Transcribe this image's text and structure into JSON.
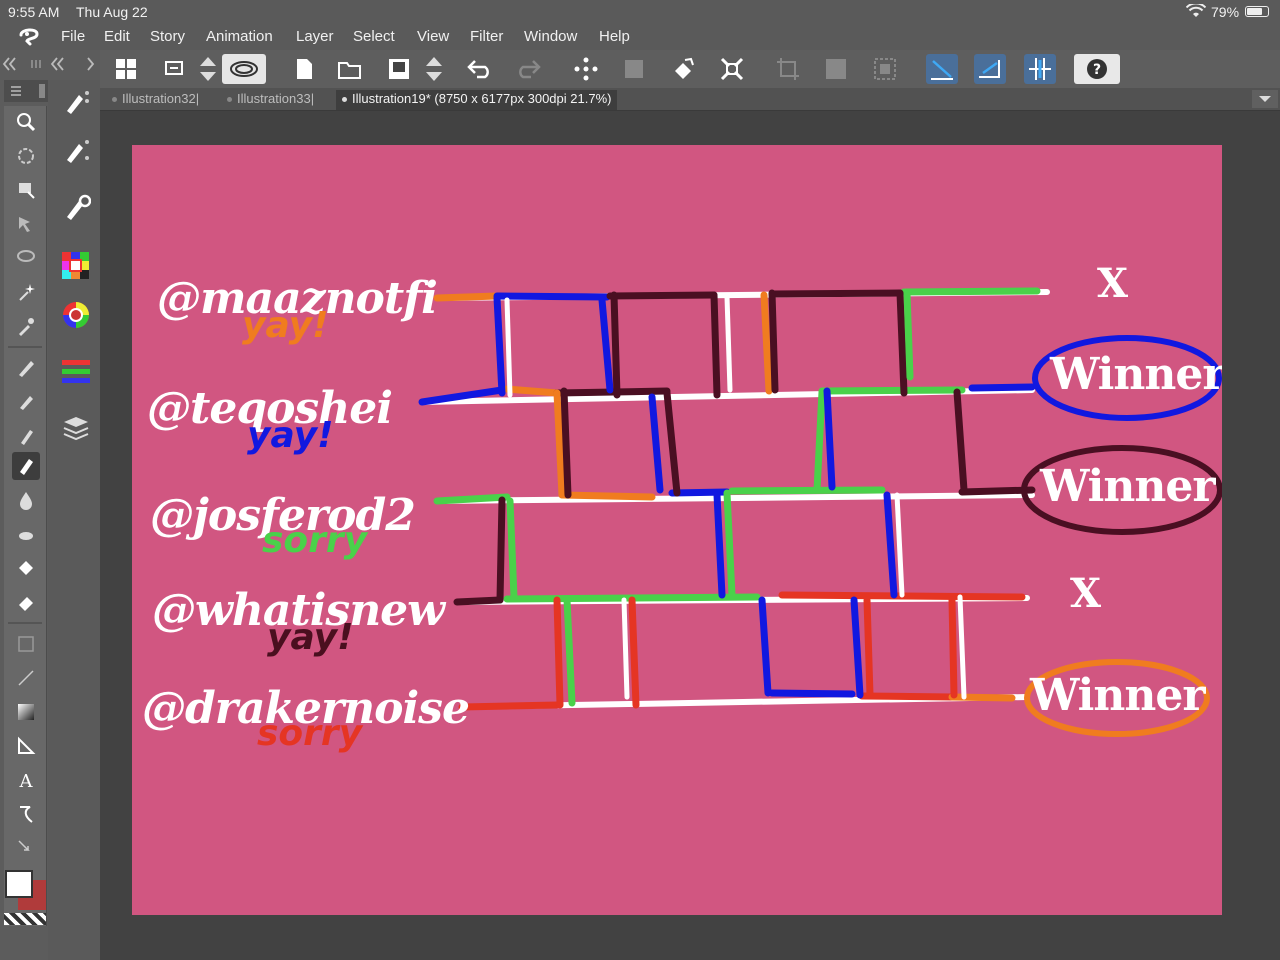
{
  "status_bar": {
    "time": "9:55 AM",
    "date": "Thu Aug 22",
    "battery": "79%",
    "battery_level": 0.79
  },
  "menu": [
    "File",
    "Edit",
    "Story",
    "Animation",
    "Layer",
    "Select",
    "View",
    "Filter",
    "Window",
    "Help"
  ],
  "tabs": [
    {
      "label": "Illustration32|"
    },
    {
      "label": "Illustration33|"
    },
    {
      "label": "Illustration19* (8750 x 6177px 300dpi 21.7%)"
    }
  ],
  "canvas": {
    "background": "#d15681",
    "handles": [
      "@maaznotfi",
      "@teqoshei",
      "@josferod2",
      "@whatisnew",
      "@drakernoise"
    ],
    "replies": [
      {
        "text": "yay!",
        "color": "#f07c1f"
      },
      {
        "text": "yay!",
        "color": "#1018e0"
      },
      {
        "text": "sorry",
        "color": "#4ad14a"
      },
      {
        "text": "yay!",
        "color": "#4a0f1f"
      },
      {
        "text": "sorry",
        "color": "#e53523"
      }
    ],
    "results": [
      {
        "text": "X",
        "circle": ""
      },
      {
        "text": "Winner",
        "circle": "#1118e0"
      },
      {
        "text": "Winner",
        "circle": "#4a0f22"
      },
      {
        "text": "X",
        "circle": ""
      },
      {
        "text": "Winner",
        "circle": "#f07c1f"
      }
    ]
  },
  "icons": {
    "toolbar": [
      "grid-icon",
      "copy-icon",
      "arrows-icon",
      "spiral-icon",
      "new-icon",
      "open-icon",
      "save-icon",
      "arrows-icon",
      "undo-icon",
      "redo-icon",
      "transform-icon",
      "layer-icon",
      "fill-icon",
      "fit-icon",
      "crop-icon",
      "square-icon",
      "selection-icon",
      "ruler-icon",
      "ruler2-icon",
      "grid-toggle-icon",
      "help-icon"
    ]
  },
  "colors": {
    "foreground": "#ffffff",
    "background": "#b03b3b"
  }
}
